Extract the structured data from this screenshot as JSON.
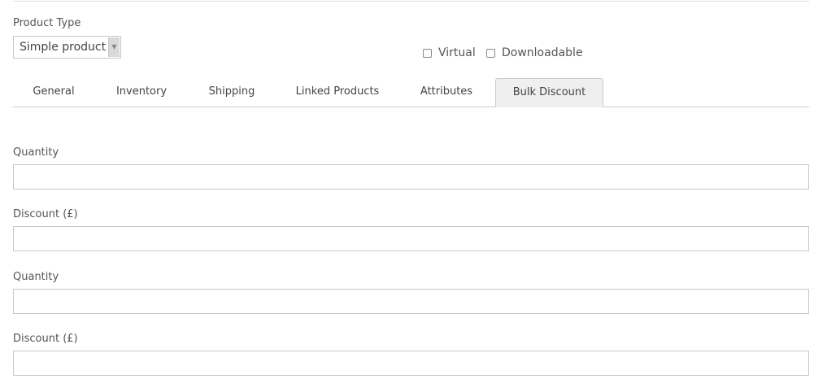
{
  "product_type": {
    "label": "Product Type",
    "selected": "Simple product"
  },
  "options": {
    "virtual_label": "Virtual",
    "downloadable_label": "Downloadable",
    "virtual_checked": false,
    "downloadable_checked": false
  },
  "tabs": [
    {
      "label": "General",
      "active": false
    },
    {
      "label": "Inventory",
      "active": false
    },
    {
      "label": "Shipping",
      "active": false
    },
    {
      "label": "Linked Products",
      "active": false
    },
    {
      "label": "Attributes",
      "active": false
    },
    {
      "label": "Bulk Discount",
      "active": true
    }
  ],
  "fields": [
    {
      "label": "Quantity",
      "value": ""
    },
    {
      "label": "Discount (£)",
      "value": ""
    },
    {
      "label": "Quantity",
      "value": ""
    },
    {
      "label": "Discount (£)",
      "value": ""
    }
  ],
  "icons": {
    "select_arrow": "chevron-down-icon"
  }
}
